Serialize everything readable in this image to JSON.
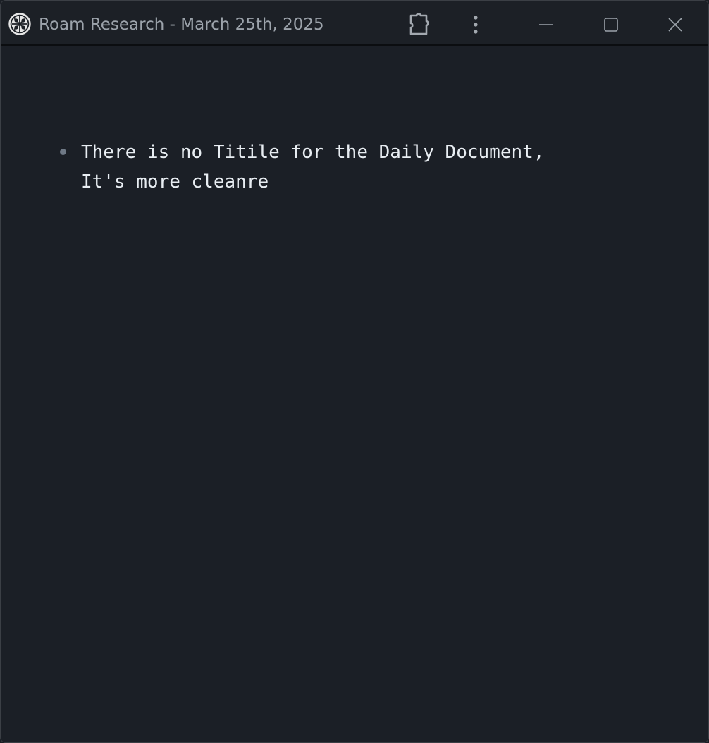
{
  "window": {
    "title": "Roam Research - March 25th, 2025",
    "app_icon": "roam-logo-icon"
  },
  "titlebar_buttons": {
    "extensions": "puzzle-piece-icon",
    "menu": "vertical-dots-icon",
    "minimize": "minimize-icon",
    "maximize": "maximize-icon",
    "close": "close-icon"
  },
  "page": {
    "blocks": [
      {
        "text": "There is no Titile for the Daily Document,\nIt's more cleanre"
      }
    ]
  },
  "colors": {
    "background": "#1b1f26",
    "title_text": "#9ca3ab",
    "body_text": "#e8edf2",
    "bullet": "#6f7986",
    "icon": "#a3a9b0"
  }
}
